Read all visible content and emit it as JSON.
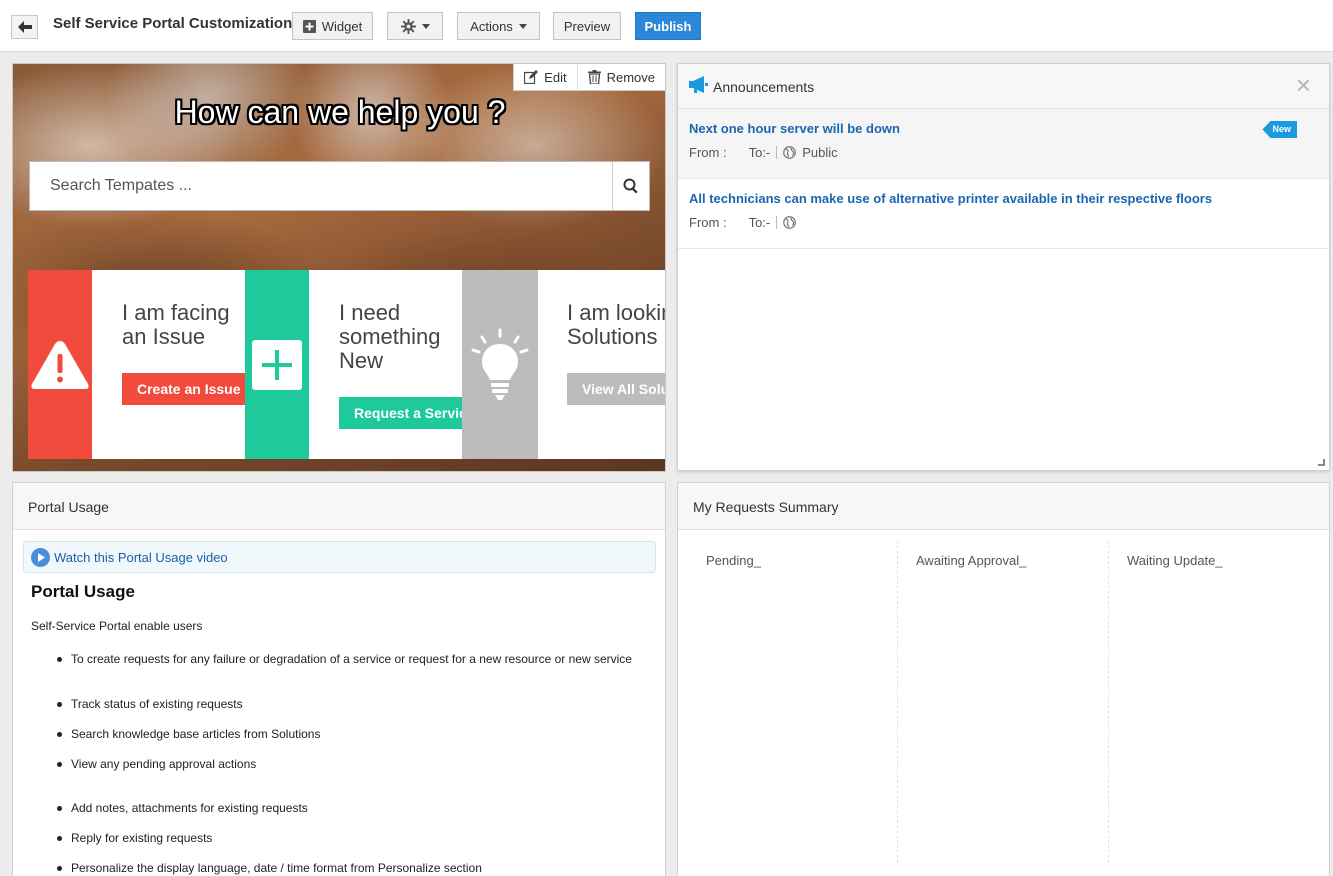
{
  "toolbar": {
    "title": "Self Service Portal Customization",
    "widget_label": "Widget",
    "actions_label": "Actions",
    "preview_label": "Preview",
    "publish_label": "Publish"
  },
  "banner": {
    "edit_label": "Edit",
    "remove_label": "Remove",
    "heading": "How can we help you ?",
    "search_placeholder": "Search Tempates ...",
    "cards": [
      {
        "text": "I am facing an Issue",
        "button": "Create an Issue",
        "color": "#f34a3e"
      },
      {
        "text": "I need something New",
        "button": "Request a Service",
        "color": "#1ec99b"
      },
      {
        "text": "I am looking for Solutions",
        "button": "View All Solutions",
        "color": "#bcbcbc"
      }
    ]
  },
  "announcements": {
    "title": "Announcements",
    "items": [
      {
        "title": "Next one hour server will be down",
        "from_label": "From :",
        "to_label": "To:-",
        "visibility": "Public",
        "badge": "New"
      },
      {
        "title": "All technicians can make use of alternative printer available in their respective floors",
        "from_label": "From :",
        "to_label": "To:-",
        "visibility": ""
      }
    ]
  },
  "portal_usage": {
    "panel_title": "Portal Usage",
    "video_link": "Watch this Portal Usage video",
    "heading": "Portal Usage",
    "intro": "Self-Service Portal enable users",
    "items": [
      "To create requests for any failure or degradation of a service or request for a new resource or new service",
      "Track status of existing requests",
      "Search knowledge base articles from Solutions",
      "View any pending approval actions",
      "Add notes, attachments for existing requests",
      "Reply for existing requests",
      "Personalize the display language, date / time format from Personalize section"
    ]
  },
  "requests_summary": {
    "title": "My Requests Summary",
    "columns": [
      "Pending_",
      "Awaiting Approval_",
      "Waiting Update_"
    ]
  },
  "colors": {
    "publish": "#2b88d8",
    "link": "#1a66b0",
    "issue": "#f34a3e",
    "service": "#1ec99b",
    "solution": "#bcbcbc",
    "new_badge": "#1b9ae0"
  }
}
